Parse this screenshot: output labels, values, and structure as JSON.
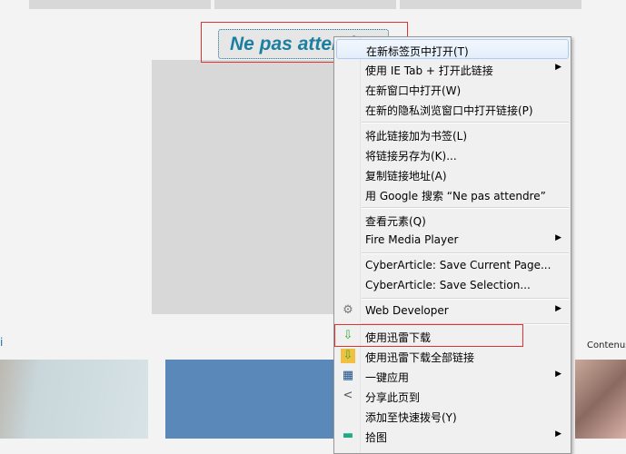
{
  "page": {
    "button_label": "Ne pas attendre",
    "link_fragment": "i",
    "contenus_label": "Contenus"
  },
  "menu": {
    "items": [
      {
        "label": "在新标签页中打开(T)",
        "submenu": false
      },
      {
        "label": "使用 IE Tab + 打开此链接",
        "submenu": true
      },
      {
        "label": "在新窗口中打开(W)",
        "submenu": false
      },
      {
        "label": "在新的隐私浏览窗口中打开链接(P)",
        "submenu": false
      },
      {
        "label": "将此链接加为书签(L)",
        "submenu": false
      },
      {
        "label": "将链接另存为(K)...",
        "submenu": false
      },
      {
        "label": "复制链接地址(A)",
        "submenu": false
      },
      {
        "label": "用 Google 搜索 “Ne pas attendre”",
        "submenu": false
      },
      {
        "label": "查看元素(Q)",
        "submenu": false
      },
      {
        "label": "Fire Media Player",
        "submenu": true
      },
      {
        "label": "CyberArticle: Save Current Page...",
        "submenu": false
      },
      {
        "label": "CyberArticle: Save Selection...",
        "submenu": false
      },
      {
        "label": "Web Developer",
        "submenu": true,
        "icon": "gear-icon"
      },
      {
        "label": "使用迅雷下载",
        "submenu": false,
        "icon": "download-arrow-icon"
      },
      {
        "label": "使用迅雷下载全部链接",
        "submenu": false,
        "icon": "download-folder-icon"
      },
      {
        "label": "一键应用",
        "submenu": true,
        "icon": "apps-icon"
      },
      {
        "label": "分享此页到",
        "submenu": false,
        "icon": "share-icon"
      },
      {
        "label": "添加至快速拨号(Y)",
        "submenu": false
      },
      {
        "label": "拾图",
        "submenu": true,
        "icon": "image-icon"
      }
    ]
  },
  "colors": {
    "accent": "#1a7fa0",
    "highlight_box": "#dd3333"
  }
}
